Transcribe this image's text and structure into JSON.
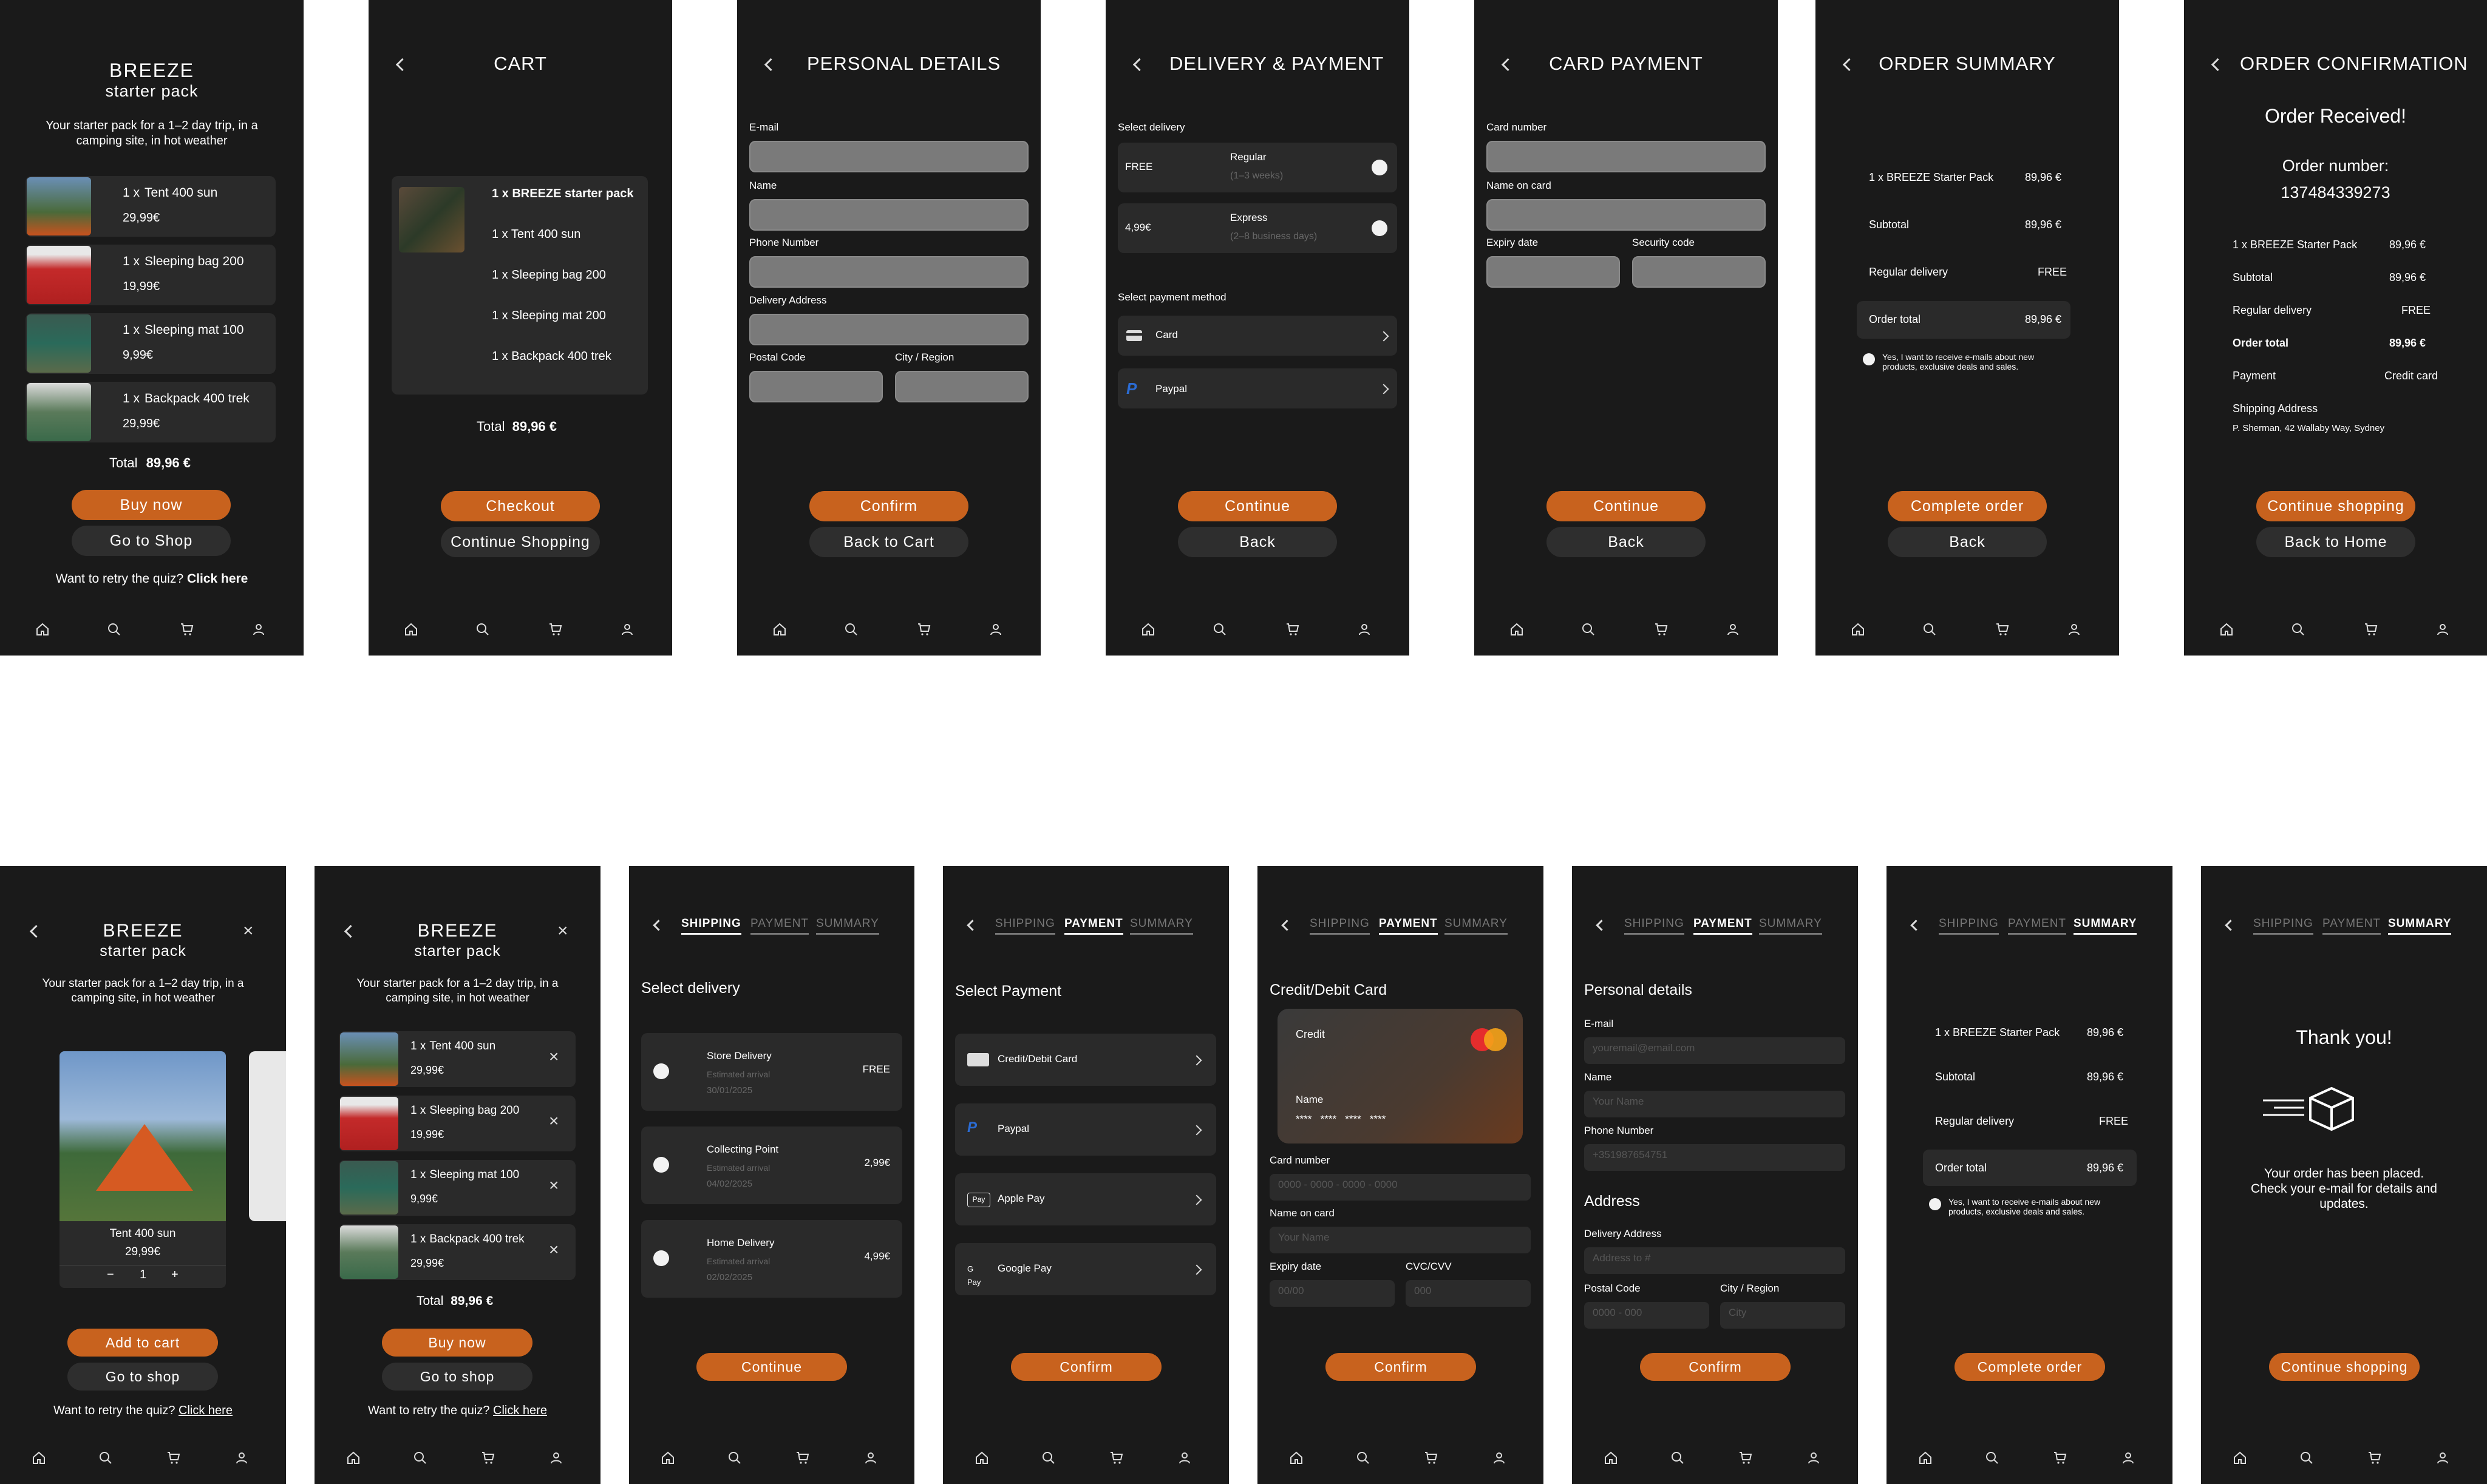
{
  "nav": [
    "home-icon",
    "search-icon",
    "cart-icon",
    "profile-icon"
  ],
  "colors": {
    "bg": "#1a1a1a",
    "accent": "#c8621e",
    "panel": "#2a2a2a",
    "field": "#7a7a7a"
  },
  "s1": {
    "brand": "BREEZE",
    "sub": "starter pack",
    "desc": "Your starter pack for a 1–2 day trip, in a camping site, in hot weather",
    "items": [
      {
        "qty": "1 x",
        "name": "Tent 400 sun",
        "price": "29,99€"
      },
      {
        "qty": "1 x",
        "name": "Sleeping bag 200",
        "price": "19,99€"
      },
      {
        "qty": "1 x",
        "name": "Sleeping mat 100",
        "price": "9,99€"
      },
      {
        "qty": "1 x",
        "name": "Backpack 400 trek",
        "price": "29,99€"
      }
    ],
    "total_label": "Total",
    "total": "89,96 €",
    "btn1": "Buy now",
    "btn2": "Go to Shop",
    "retry": "Want to retry the quiz?",
    "retry_link": "Click here"
  },
  "s2": {
    "title": "CART",
    "lines": [
      "1 x BREEZE starter pack",
      "1 x Tent 400 sun",
      "1 x Sleeping bag 200",
      "1 x Sleeping mat 200",
      "1 x Backpack 400 trek"
    ],
    "total_label": "Total",
    "total": "89,96 €",
    "btn1": "Checkout",
    "btn2": "Continue Shopping"
  },
  "s3": {
    "title": "PERSONAL DETAILS",
    "f1": "E-mail",
    "f2": "Name",
    "f3": "Phone Number",
    "f4": "Delivery Address",
    "f5": "Postal Code",
    "f6": "City / Region",
    "btn1": "Confirm",
    "btn2": "Back to Cart"
  },
  "s4": {
    "title": "DELIVERY & PAYMENT",
    "sel_delivery": "Select delivery",
    "opt1_price": "FREE",
    "opt1_name": "Regular",
    "opt1_time": "(1–3 weeks)",
    "opt2_price": "4,99€",
    "opt2_name": "Express",
    "opt2_time": "(2–8 business days)",
    "sel_payment": "Select payment method",
    "pay1": "Card",
    "pay2": "Paypal",
    "btn1": "Continue",
    "btn2": "Back"
  },
  "s5": {
    "title": "CARD PAYMENT",
    "f1": "Card number",
    "f2": "Name on card",
    "f3": "Expiry date",
    "f4": "Security code",
    "btn1": "Continue",
    "btn2": "Back"
  },
  "s6": {
    "title": "ORDER SUMMARY",
    "r1l": "1 x BREEZE Starter Pack",
    "r1v": "89,96 €",
    "r2l": "Subtotal",
    "r2v": "89,96 €",
    "r3l": "Regular delivery",
    "r3v": "FREE",
    "r4l": "Order total",
    "r4v": "89,96 €",
    "optin": "Yes, I want to receive e-mails about new products, exclusive deals and sales.",
    "btn1": "Complete order",
    "btn2": "Back"
  },
  "s7": {
    "title": "ORDER CONFIRMATION",
    "received": "Order Received!",
    "num_label": "Order number:",
    "num": "137484339273",
    "r1l": "1 x BREEZE Starter Pack",
    "r1v": "89,96 €",
    "r2l": "Subtotal",
    "r2v": "89,96 €",
    "r3l": "Regular delivery",
    "r3v": "FREE",
    "r4l": "Order total",
    "r4v": "89,96 €",
    "r5l": "Payment",
    "r5v": "Credit card",
    "addr_label": "Shipping Address",
    "addr": "P. Sherman, 42 Wallaby Way, Sydney",
    "btn1": "Continue shopping",
    "btn2": "Back to Home"
  },
  "m1": {
    "brand": "BREEZE",
    "sub": "starter pack",
    "desc": "Your starter pack for a 1–2 day trip, in a camping site, in hot weather",
    "card_name": "Tent 400 sun",
    "card_price": "29,99€",
    "minus": "−",
    "qty": "1",
    "plus": "+",
    "btn1": "Add to cart",
    "btn2": "Go to shop",
    "retry": "Want to retry the quiz?",
    "retry_link": "Click here"
  },
  "m2": {
    "brand": "BREEZE",
    "sub": "starter pack",
    "desc": "Your starter pack for a 1–2 day trip, in a camping site, in hot weather",
    "items": [
      {
        "qty": "1 x",
        "name": "Tent 400 sun",
        "price": "29,99€"
      },
      {
        "qty": "1 x",
        "name": "Sleeping bag 200",
        "price": "19,99€"
      },
      {
        "qty": "1 x",
        "name": "Sleeping mat 100",
        "price": "9,99€"
      },
      {
        "qty": "1 x",
        "name": "Backpack 400 trek",
        "price": "29,99€"
      }
    ],
    "total_label": "Total",
    "total": "89,96 €",
    "btn1": "Buy now",
    "btn2": "Go to shop",
    "retry": "Want to retry the quiz?",
    "retry_link": "Click here"
  },
  "tabs": {
    "shipping": "SHIPPING",
    "payment": "PAYMENT",
    "summary": "SUMMARY"
  },
  "m3": {
    "heading": "Select delivery",
    "opts": [
      {
        "name": "Store Delivery",
        "eta": "Estimated arrival",
        "date": "30/01/2025",
        "price": "FREE"
      },
      {
        "name": "Collecting Point",
        "eta": "Estimated arrival",
        "date": "04/02/2025",
        "price": "2,99€"
      },
      {
        "name": "Home Delivery",
        "eta": "Estimated arrival",
        "date": "02/02/2025",
        "price": "4,99€"
      }
    ],
    "btn": "Continue"
  },
  "m4": {
    "heading": "Select Payment",
    "opts": [
      "Credit/Debit Card",
      "Paypal",
      "Apple Pay",
      "Google Pay"
    ],
    "btn": "Confirm"
  },
  "m5": {
    "heading": "Credit/Debit Card",
    "card_credit": "Credit",
    "card_name": "Name",
    "card_mask": "****   ****   ****   ****",
    "f1": "Card number",
    "p1": "0000 - 0000 - 0000 - 0000",
    "f2": "Name on card",
    "p2": "Your Name",
    "f3": "Expiry date",
    "p3": "00/00",
    "f4": "CVC/CVV",
    "p4": "000",
    "btn": "Confirm"
  },
  "m6": {
    "heading": "Personal details",
    "f1": "E-mail",
    "p1": "youremail@email.com",
    "f2": "Name",
    "p2": "Your Name",
    "f3": "Phone Number",
    "p3": "+351987654751",
    "addr_heading": "Address",
    "f4": "Delivery Address",
    "p4": "Address to #",
    "f5": "Postal Code",
    "p5": "0000 - 000",
    "f6": "City / Region",
    "p6": "City",
    "btn": "Confirm"
  },
  "m7": {
    "r1l": "1 x BREEZE Starter Pack",
    "r1v": "89,96 €",
    "r2l": "Subtotal",
    "r2v": "89,96 €",
    "r3l": "Regular delivery",
    "r3v": "FREE",
    "r4l": "Order total",
    "r4v": "89,96 €",
    "optin": "Yes, I want to receive e-mails about new products, exclusive deals and sales.",
    "btn": "Complete order"
  },
  "m8": {
    "thanks": "Thank you!",
    "msg": "Your order has been placed. Check your e-mail for details and updates.",
    "btn": "Continue shopping"
  }
}
